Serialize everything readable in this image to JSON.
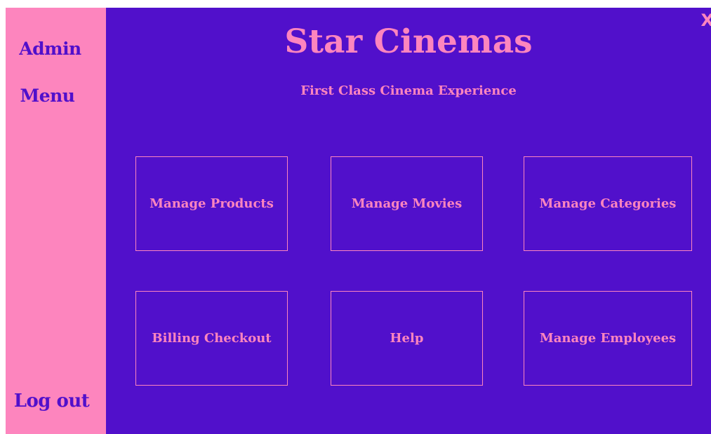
{
  "colors": {
    "background": "#5110cb",
    "sidebar": "#fd85be",
    "accent": "#fd85be"
  },
  "sidebar": {
    "admin_label": "Admin",
    "menu_label": "Menu",
    "logout_label": "Log out"
  },
  "header": {
    "title": "Star Cinemas",
    "subtitle": "First Class Cinema Experience",
    "close_label": "X"
  },
  "tiles": [
    {
      "label": "Manage Products"
    },
    {
      "label": "Manage Movies"
    },
    {
      "label": "Manage Categories"
    },
    {
      "label": "Billing Checkout"
    },
    {
      "label": "Help"
    },
    {
      "label": "Manage Employees"
    }
  ]
}
